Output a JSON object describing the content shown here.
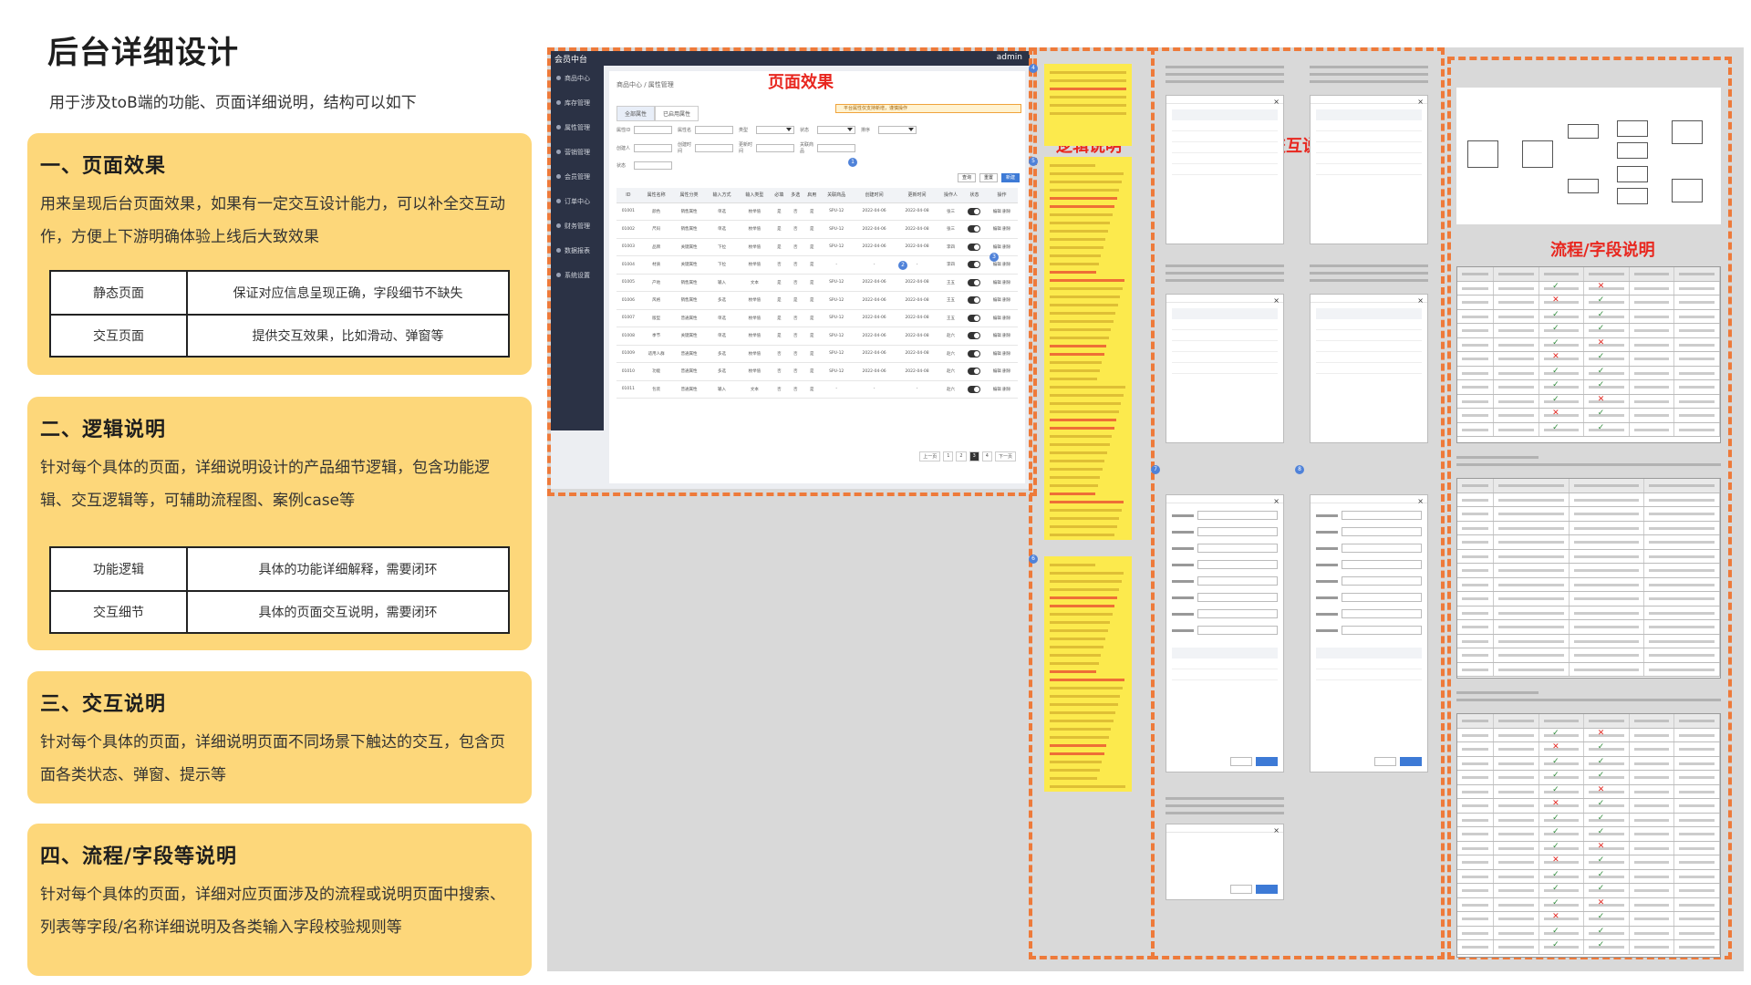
{
  "header": {
    "title": "后台详细设计",
    "subtitle": "用于涉及toB端的功能、页面详细说明，结构可以如下"
  },
  "sections": [
    {
      "title": "一、页面效果",
      "desc": "用来呈现后台页面效果，如果有一定交互设计能力，可以补全交互动作，方便上下游明确体验上线后大致效果",
      "rows": [
        {
          "k": "静态页面",
          "v": "保证对应信息呈现正确，字段细节不缺失"
        },
        {
          "k": "交互页面",
          "v": "提供交互效果，比如滑动、弹窗等"
        }
      ]
    },
    {
      "title": "二、逻辑说明",
      "desc": "针对每个具体的页面，详细说明设计的产品细节逻辑，包含功能逻辑、交互逻辑等，可辅助流程图、案例case等",
      "rows": [
        {
          "k": "功能逻辑",
          "v": "具体的功能详细解释，需要闭环"
        },
        {
          "k": "交互细节",
          "v": "具体的页面交互说明，需要闭环"
        }
      ]
    },
    {
      "title": "三、交互说明",
      "desc": "针对每个具体的页面，详细说明页面不同场景下触达的交互，包含页面各类状态、弹窗、提示等"
    },
    {
      "title": "四、流程/字段等说明",
      "desc": "针对每个具体的页面，详细对应页面涉及的流程或说明页面中搜索、列表等字段/名称详细说明及各类输入字段校验规则等"
    }
  ],
  "preview": {
    "labels": {
      "page_effect": "页面效果",
      "logic": "逻辑说明",
      "interaction": "交互说明",
      "flow_fields": "流程/字段说明"
    },
    "colors": {
      "dash": "#ee7a3a",
      "label": "#e8271f",
      "card": "#fdd77a",
      "sticky": "#fcea4d"
    },
    "admin": {
      "logo": "会员中台",
      "user": "admin",
      "crumb": "商品中心 / 属性管理",
      "tabs": [
        "全部属性",
        "已启用属性"
      ],
      "warning": "平台属性仅支持新增，谨慎操作",
      "nav": [
        "商品中心",
        "库存管理",
        "属性管理",
        "营销管理",
        "会员管理",
        "订单中心",
        "财务管理",
        "数据报表",
        "系统设置"
      ],
      "filter_labels": [
        "属性ID",
        "属性名",
        "类型",
        "状态",
        "排序",
        "创建人",
        "创建时间",
        "更新时间",
        "关联商品"
      ],
      "buttons": [
        "查询",
        "重置",
        "新建"
      ],
      "table_headers": [
        "ID",
        "属性名称",
        "属性分类",
        "输入方式",
        "输入类型",
        "必填",
        "多选",
        "启用",
        "关联商品",
        "创建时间",
        "更新时间",
        "操作人",
        "状态",
        "操作"
      ],
      "rows": [
        [
          "01001",
          "颜色",
          "销售属性",
          "单选",
          "枚举值",
          "是",
          "否",
          "是",
          "SPU-12",
          "2022-04-06",
          "2022-04-08",
          "张三",
          "",
          "编辑 删除"
        ],
        [
          "01002",
          "尺码",
          "销售属性",
          "单选",
          "枚举值",
          "是",
          "否",
          "是",
          "SPU-12",
          "2022-04-06",
          "2022-04-08",
          "张三",
          "",
          "编辑 删除"
        ],
        [
          "01003",
          "品牌",
          "关键属性",
          "下拉",
          "枚举值",
          "是",
          "否",
          "是",
          "SPU-12",
          "2022-04-06",
          "2022-04-08",
          "李四",
          "",
          "编辑 删除"
        ],
        [
          "01004",
          "材质",
          "关键属性",
          "下拉",
          "枚举值",
          "否",
          "否",
          "是",
          "-",
          "-",
          "-",
          "李四",
          "",
          "编辑 删除"
        ],
        [
          "01005",
          "产地",
          "销售属性",
          "输入",
          "文本",
          "是",
          "否",
          "是",
          "SPU-12",
          "2022-04-06",
          "2022-04-08",
          "王五",
          "",
          "编辑 删除"
        ],
        [
          "01006",
          "风格",
          "销售属性",
          "多选",
          "枚举值",
          "是",
          "是",
          "是",
          "SPU-12",
          "2022-04-06",
          "2022-04-08",
          "王五",
          "",
          "编辑 删除"
        ],
        [
          "01007",
          "版型",
          "普通属性",
          "单选",
          "枚举值",
          "是",
          "否",
          "是",
          "SPU-12",
          "2022-04-06",
          "2022-04-08",
          "王五",
          "",
          "编辑 删除"
        ],
        [
          "01008",
          "季节",
          "关键属性",
          "单选",
          "枚举值",
          "是",
          "否",
          "是",
          "SPU-12",
          "2022-04-06",
          "2022-04-08",
          "赵六",
          "",
          "编辑 删除"
        ],
        [
          "01009",
          "适用人群",
          "普通属性",
          "多选",
          "枚举值",
          "否",
          "否",
          "是",
          "SPU-12",
          "2022-04-06",
          "2022-04-08",
          "赵六",
          "",
          "编辑 删除"
        ],
        [
          "01010",
          "功能",
          "普通属性",
          "多选",
          "枚举值",
          "否",
          "否",
          "是",
          "SPU-12",
          "2022-04-06",
          "2022-04-08",
          "赵六",
          "",
          "编辑 删除"
        ],
        [
          "01011",
          "包装",
          "普通属性",
          "输入",
          "文本",
          "否",
          "否",
          "是",
          "-",
          "-",
          "-",
          "赵六",
          "",
          "编辑 删除"
        ]
      ],
      "pager": [
        "上一页",
        "1",
        "2",
        "3",
        "4",
        "下一页"
      ]
    },
    "badges": [
      "1",
      "2",
      "3",
      "4",
      "5",
      "6",
      "7",
      "8"
    ]
  }
}
